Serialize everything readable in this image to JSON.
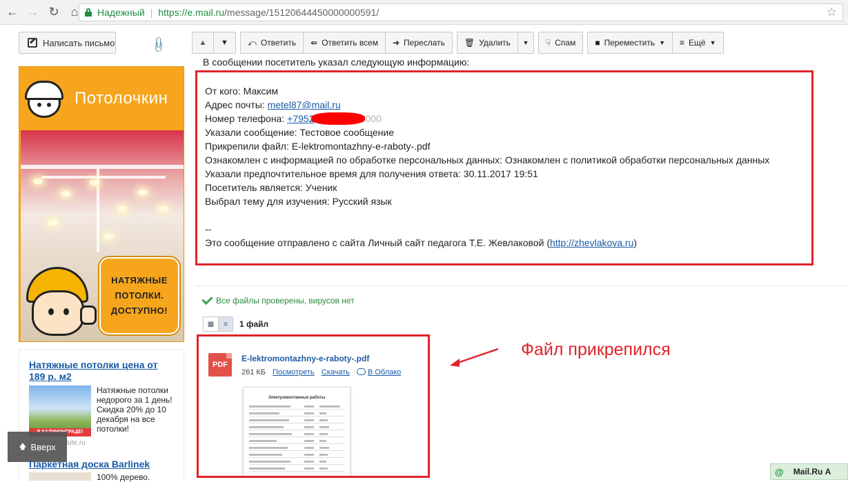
{
  "browser": {
    "secure_label": "Надежный",
    "url_host": "https://e.mail.ru",
    "url_path": "/message/15120644450000000591/"
  },
  "sidebar": {
    "compose_label": "Написать письмо",
    "up_label": "Вверх"
  },
  "ad_banner": {
    "brand": "Потолочкин",
    "badge": "НАТЯЖНЫЕ\nПОТОЛКИ.\nДОСТУПНО!"
  },
  "ad_text": {
    "link1": "Натяжные потолки цена от 189 р. м2",
    "img1_band": "В КАЛИНИНГРАДЕ!",
    "desc1": "Натяжные потолки недорого за 1 день! Скидка 20% до 10 декабря на все потолки!",
    "source1": "potolki-absolute.ru",
    "link2": "Паркетная доска Barlinek",
    "desc2": "100% дерево."
  },
  "toolbar": {
    "reply": "Ответить",
    "reply_all": "Ответить всем",
    "forward": "Переслать",
    "delete": "Удалить",
    "spam": "Спам",
    "move": "Переместить",
    "more": "Ещё"
  },
  "message": {
    "intro": "В сообщении посетитель указал следующую информацию:",
    "from_label": "От кого: Максим",
    "email_label": "Адрес почты: ",
    "email_value": "metel87@mail.ru",
    "phone_label": "Номер телефона: ",
    "phone_value": "+7952",
    "phone_tail": "000",
    "line_message": "Указали сообщение: Тестовое сообщение",
    "line_file": "Прикрепили файл: E-lektromontazhny-e-raboty-.pdf",
    "line_consent": "Ознакомлен с информацией по обработке персональных данных: Ознакомлен с политикой обработки персональных данных",
    "line_time": "Указали предпочтительное время для получения ответа: 30.11.2017 19:51",
    "line_visitor": "Посетитель является: Ученик",
    "line_topic": "Выбрал тему для изучения: Русский язык",
    "signature_dash": "--",
    "footer_text": "Это сообщение отправлено с сайта Личный сайт педагога Т.Е. Жевлаковой (",
    "footer_link": "http://zhevlakova.ru",
    "footer_close": ")"
  },
  "attachments": {
    "virus_status": "Все файлы проверены, вирусов нет",
    "count_label": "1 файл",
    "file": {
      "type_badge": "PDF",
      "name": "E-lektromontazhny-e-raboty-.pdf",
      "size": "261 КБ",
      "view_label": "Посмотреть",
      "download_label": "Скачать",
      "cloud_label": "В Облако",
      "thumb_title": "Электромонтажные работы"
    }
  },
  "annotation": {
    "text": "Файл прикрепился",
    "color": "#e0232b"
  },
  "footer_tab": {
    "label": "Mail.Ru А"
  }
}
